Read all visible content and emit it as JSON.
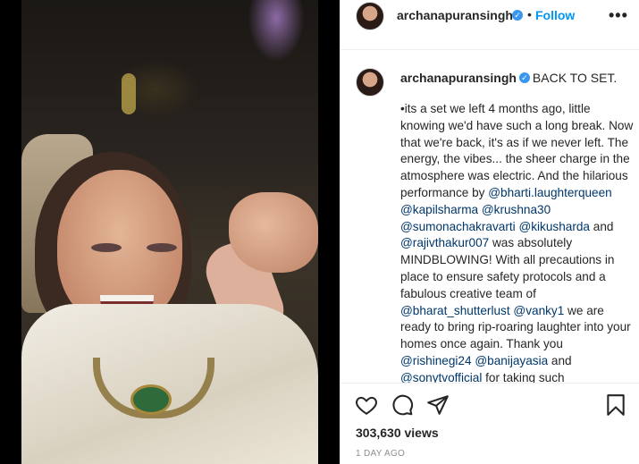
{
  "post": {
    "username": "archanapuransingh",
    "verified_badge": "✓",
    "separator": "•",
    "follow_label": "Follow",
    "more_label": "•••"
  },
  "caption": {
    "username": "archanapuransingh",
    "title": "BACK TO SET.",
    "segments": [
      {
        "t": "•its a set we left 4 months ago, little knowing we'd have such a long break. Now that we're back, it's as if we never left. The energy, the vibes... the sheer charge in the atmosphere was electric. And the hilarious performance by ",
        "m": false
      },
      {
        "t": "@bharti.laughterqueen",
        "m": true
      },
      {
        "t": " ",
        "m": false
      },
      {
        "t": "@kapilsharma",
        "m": true
      },
      {
        "t": " ",
        "m": false
      },
      {
        "t": "@krushna30",
        "m": true
      },
      {
        "t": " ",
        "m": false
      },
      {
        "t": "@sumonachakravarti",
        "m": true
      },
      {
        "t": " ",
        "m": false
      },
      {
        "t": "@kikusharda",
        "m": true
      },
      {
        "t": " and ",
        "m": false
      },
      {
        "t": "@rajivthakur007",
        "m": true
      },
      {
        "t": " was absolutely MINDBLOWING! With all precautions in place to ensure safety protocols and a fabulous creative team of ",
        "m": false
      },
      {
        "t": "@bharat_shutterlust",
        "m": true
      },
      {
        "t": " ",
        "m": false
      },
      {
        "t": "@vanky1",
        "m": true
      },
      {
        "t": " we are ready to bring rip-roaring laughter into your homes once again. Thank you ",
        "m": false
      },
      {
        "t": "@rishinegi24",
        "m": true
      },
      {
        "t": " ",
        "m": false
      },
      {
        "t": "@banijayasia",
        "m": true
      },
      {
        "t": " and ",
        "m": false
      },
      {
        "t": "@sonytvofficial",
        "m": true
      },
      {
        "t": " for taking such",
        "m": false
      }
    ]
  },
  "actions": {
    "icons": [
      "heart-icon",
      "comment-icon",
      "share-icon",
      "bookmark-icon"
    ]
  },
  "stats": {
    "views": "303,630 views",
    "timestamp": "1 DAY AGO"
  },
  "colors": {
    "link": "#0095f6",
    "mention": "#00376b",
    "verified": "#3897f0",
    "muted": "#8e8e8e"
  }
}
